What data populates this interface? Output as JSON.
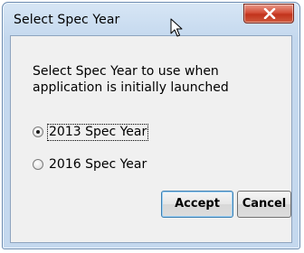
{
  "window": {
    "title": "Select Spec Year"
  },
  "dialog": {
    "prompt": "Select Spec Year to use when application is initially launched",
    "options": [
      {
        "label": "2013 Spec Year",
        "checked": true
      },
      {
        "label": "2016 Spec Year",
        "checked": false
      }
    ]
  },
  "buttons": {
    "accept": "Accept",
    "cancel": "Cancel"
  },
  "icons": {
    "close": "close-icon",
    "cursor": "mouse-pointer-icon"
  },
  "colors": {
    "title_bar": "#c4d8ee",
    "close_button": "#c2331c",
    "client_background": "#f0f0f0"
  }
}
